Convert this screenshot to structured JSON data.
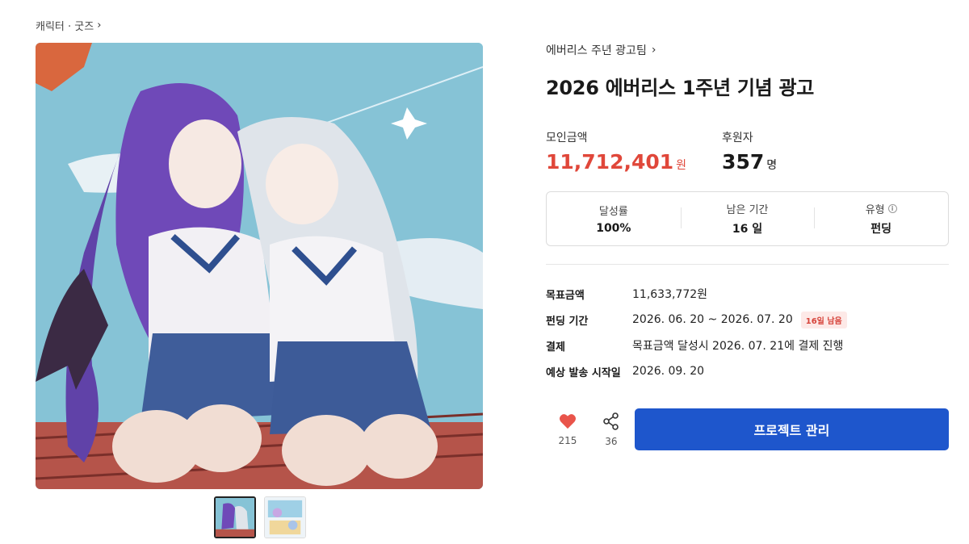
{
  "breadcrumb": {
    "label": "캐릭터 · 굿즈",
    "chevron": "›"
  },
  "creator": {
    "name": "에버리스 주년 광고팀",
    "chevron": "›"
  },
  "title": "2026 에버리스 1주년 기념 광고",
  "stats": {
    "amount": {
      "label": "모인금액",
      "value": "11,712,401",
      "unit": "원"
    },
    "backers": {
      "label": "후원자",
      "value": "357",
      "unit": "명"
    }
  },
  "summary": {
    "rate": {
      "label": "달성률",
      "value": "100%"
    },
    "remaining": {
      "label": "남은 기간",
      "value": "16 일"
    },
    "type": {
      "label": "유형",
      "value": "펀딩",
      "info_icon": "i"
    }
  },
  "details": [
    {
      "key": "목표금액",
      "value": "11,633,772원",
      "badge": ""
    },
    {
      "key": "펀딩 기간",
      "value": "2026. 06. 20 ~ 2026. 07. 20",
      "badge": "16일 남음"
    },
    {
      "key": "결제",
      "value": "목표금액 달성시 2026. 07. 21에 결제 진행",
      "badge": ""
    },
    {
      "key": "예상 발송 시작일",
      "value": "2026. 09. 20",
      "badge": ""
    }
  ],
  "actions": {
    "like": {
      "count": "215"
    },
    "share": {
      "count": "36"
    },
    "manage_label": "프로젝트 관리"
  },
  "colors": {
    "accent": "#1e56cc",
    "amount": "#e0473a",
    "heart": "#e9544a"
  }
}
